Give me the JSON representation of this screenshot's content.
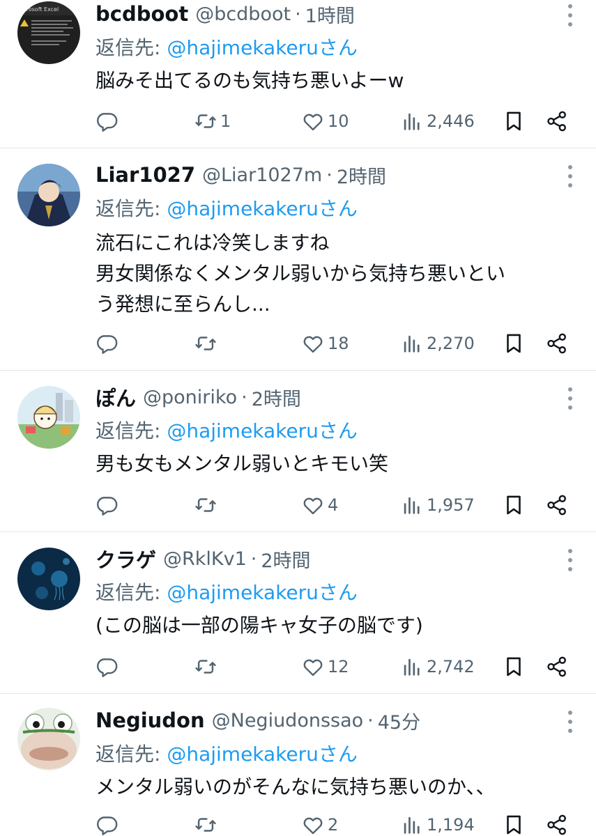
{
  "reply_prefix": "返信先: ",
  "reply_suffix": "さん",
  "tweets": [
    {
      "name": "bcdboot",
      "handle": "@bcdboot",
      "separator": "·",
      "time": "1時間",
      "reply_to": "@hajimekakeru",
      "text_lines": [
        "脳みそ出てるのも気持ち悪いよーw"
      ],
      "avatar_text": "icrosoft Excel",
      "replies": "",
      "retweets": "1",
      "likes": "10",
      "views": "2,446"
    },
    {
      "name": "Liar1027",
      "handle": "@Liar1027m",
      "separator": "·",
      "time": "2時間",
      "reply_to": "@hajimekakeru",
      "text_lines": [
        "流石にこれは冷笑しますね",
        "男女関係なくメンタル弱いから気持ち悪いとい",
        "う発想に至らんし..."
      ],
      "replies": "",
      "retweets": "",
      "likes": "18",
      "views": "2,270"
    },
    {
      "name": "ぽん",
      "handle": "@poniriko",
      "separator": "·",
      "time": "2時間",
      "reply_to": "@hajimekakeru",
      "text_lines": [
        "男も女もメンタル弱いとキモい笑"
      ],
      "replies": "",
      "retweets": "",
      "likes": "4",
      "views": "1,957"
    },
    {
      "name": "クラゲ",
      "handle": "@RklKv1",
      "separator": "·",
      "time": "2時間",
      "reply_to": "@hajimekakeru",
      "text_lines": [
        "(この脳は一部の陽キャ女子の脳です)"
      ],
      "replies": "",
      "retweets": "",
      "likes": "12",
      "views": "2,742"
    },
    {
      "name": "Negiudon",
      "handle": "@Negiudonssao",
      "separator": "·",
      "time": "45分",
      "reply_to": "@hajimekakeru",
      "text_lines": [
        "メンタル弱いのがそんなに気持ち悪いのか、、"
      ],
      "replies": "",
      "retweets": "",
      "likes": "2",
      "views": "1,194"
    }
  ],
  "colors": {
    "text": "#0f1419",
    "secondary": "#536471",
    "link": "#1d9bf0",
    "divider": "#e3e6ea"
  },
  "icons": [
    "reply-icon",
    "retweet-icon",
    "like-icon",
    "views-icon",
    "bookmark-icon",
    "share-icon",
    "more-icon"
  ]
}
